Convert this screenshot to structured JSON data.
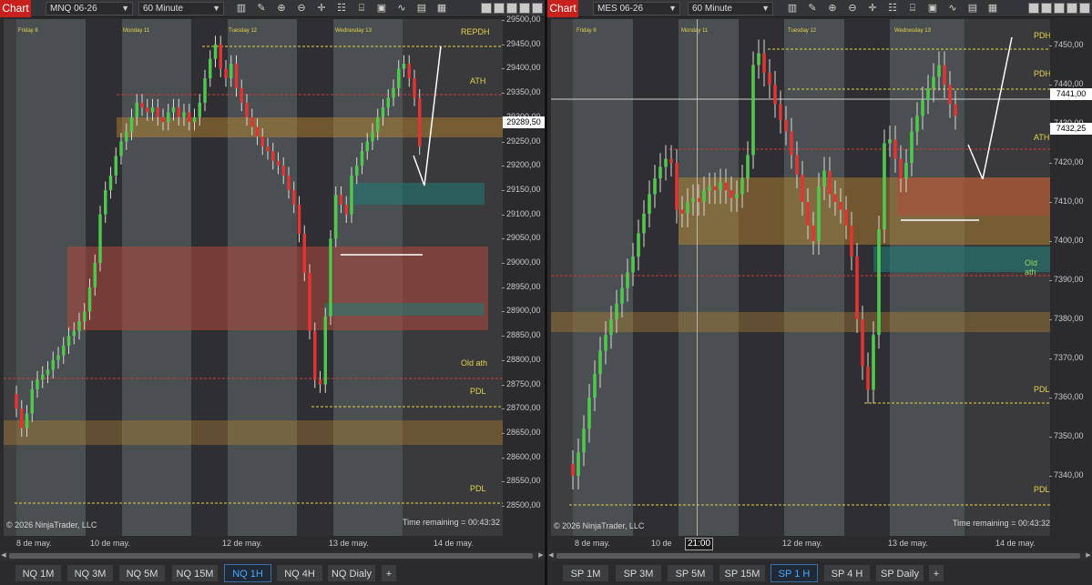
{
  "panels": [
    {
      "id": "left",
      "chart_button": "Chart",
      "instrument": "MNQ 06-26",
      "interval": "60 Minute",
      "y_ticks": [
        "29500,00",
        "29450,00",
        "29400,00",
        "29350,00",
        "29300,00",
        "29250,00",
        "29200,00",
        "29150,00",
        "29100,00",
        "29050,00",
        "29000,00",
        "28950,00",
        "28900,00",
        "28850,00",
        "28800,00",
        "28750,00",
        "28700,00",
        "28650,00",
        "28600,00",
        "28550,00",
        "28500,00"
      ],
      "price_labels": [
        {
          "text": "29289,50",
          "bg": "#ffffff",
          "fg": "#000000"
        }
      ],
      "x_ticks": [
        "8 de may.",
        "10 de may.",
        "12 de may.",
        "13 de may.",
        "14 de may."
      ],
      "day_labels": [
        "Friday 8",
        "Monday 11",
        "Tuesday 12",
        "Wednesday 13"
      ],
      "levels": [
        "REPDH",
        "ATH",
        "Old ath",
        "PDL",
        "PDL"
      ],
      "copyright": "© 2026 NinjaTrader, LLC",
      "time_remaining": "Time remaining = 00:43:32",
      "tabs": [
        "NQ 1M",
        "NQ 3M",
        "NQ 5M",
        "NQ 15M",
        "NQ 1H",
        "NQ 4H",
        "NQ Dialy",
        "+"
      ],
      "active_tab": "NQ 1H"
    },
    {
      "id": "right",
      "chart_button": "Chart",
      "instrument": "MES 06-26",
      "interval": "60 Minute",
      "y_ticks": [
        "7450,00",
        "7440,00",
        "7430,00",
        "7420,00",
        "7410,00",
        "7400,00",
        "7390,00",
        "7380,00",
        "7370,00",
        "7360,00",
        "7350,00",
        "7340,00"
      ],
      "price_labels": [
        {
          "text": "7441,00",
          "bg": "#ffffff",
          "fg": "#000000"
        },
        {
          "text": "7432,25",
          "bg": "#ffffff",
          "fg": "#000000"
        }
      ],
      "x_ticks": [
        "8 de may.",
        "10 de",
        "12 de may.",
        "13 de may.",
        "14 de may."
      ],
      "crosshair_time": "21:00",
      "day_labels": [
        "Friday 8",
        "Monday 11",
        "Tuesday 12",
        "Wednesday 13"
      ],
      "levels": [
        "PDH",
        "PDH",
        "ATH",
        "Old ath",
        "PDL",
        "PDL"
      ],
      "copyright": "© 2026 NinjaTrader, LLC",
      "time_remaining": "Time remaining = 00:43:32",
      "tabs": [
        "SP 1M",
        "SP 3M",
        "SP 5M",
        "SP 15M",
        "SP 1 H",
        "SP 4 H",
        "SP Daily",
        "+"
      ],
      "active_tab": "SP 1 H"
    }
  ],
  "colors": {
    "bull": "#4ec94e",
    "bear": "#e53333",
    "level_line": "#e6d24a",
    "resistance": "#d23a2e",
    "chart_button": "#c8211d"
  },
  "chart_data": [
    {
      "type": "candlestick",
      "instrument": "MNQ 06-26",
      "interval": "60 Minute",
      "ylim": [
        28480,
        29560
      ],
      "close": [
        28700,
        28660,
        28690,
        28740,
        28760,
        28770,
        28780,
        28800,
        28810,
        28830,
        28850,
        28860,
        28880,
        28900,
        28950,
        29000,
        29100,
        29150,
        29180,
        29220,
        29250,
        29270,
        29300,
        29330,
        29320,
        29310,
        29320,
        29300,
        29290,
        29310,
        29320,
        29300,
        29310,
        29290,
        29300,
        29330,
        29380,
        29420,
        29450,
        29400,
        29380,
        29410,
        29360,
        29330,
        29300,
        29280,
        29260,
        29240,
        29230,
        29210,
        29200,
        29180,
        29150,
        29120,
        29060,
        28980,
        28860,
        28760,
        28750,
        28890,
        29050,
        29140,
        29120,
        29100,
        29180,
        29200,
        29230,
        29250,
        29270,
        29300,
        29320,
        29340,
        29360,
        29400,
        29410,
        29380,
        29340,
        29240
      ]
    },
    {
      "type": "candlestick",
      "instrument": "MES 06-26",
      "interval": "60 Minute",
      "ylim": [
        7333,
        7459
      ],
      "close": [
        7340,
        7346,
        7352,
        7360,
        7366,
        7372,
        7376,
        7380,
        7384,
        7388,
        7392,
        7396,
        7402,
        7407,
        7412,
        7416,
        7419,
        7421,
        7420,
        7408,
        7407,
        7410,
        7411,
        7410,
        7413,
        7414,
        7413,
        7415,
        7413,
        7411,
        7412,
        7416,
        7422,
        7445,
        7448,
        7443,
        7440,
        7435,
        7431,
        7428,
        7422,
        7417,
        7410,
        7404,
        7400,
        7414,
        7418,
        7412,
        7410,
        7408,
        7404,
        7396,
        7380,
        7368,
        7362,
        7376,
        7403,
        7425,
        7426,
        7421,
        7416,
        7420,
        7428,
        7432,
        7436,
        7439,
        7442,
        7445,
        7440,
        7435,
        7432
      ]
    }
  ]
}
